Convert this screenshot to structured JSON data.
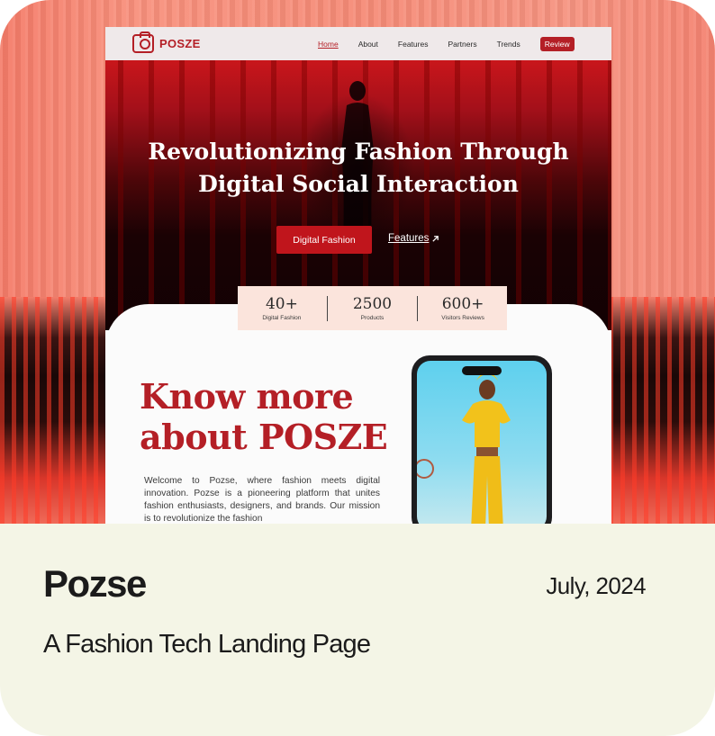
{
  "card": {
    "title": "Pozse",
    "date": "July, 2024",
    "subtitle": "A Fashion Tech Landing Page"
  },
  "site": {
    "logo_text": "POSZE",
    "nav": {
      "items": [
        {
          "label": "Home",
          "active": true
        },
        {
          "label": "About",
          "active": false
        },
        {
          "label": "Features",
          "active": false
        },
        {
          "label": "Partners",
          "active": false
        },
        {
          "label": "Trends",
          "active": false
        }
      ],
      "cta_label": "Review"
    },
    "hero": {
      "title_line1": "Revolutionizing Fashion Through",
      "title_line2": "Digital Social Interaction",
      "primary_button": "Digital Fashion",
      "secondary_link": "Features",
      "secondary_link_icon": "arrow-up-right-icon"
    },
    "stats": [
      {
        "value": "40+",
        "label": "Digital Fashion"
      },
      {
        "value": "2500",
        "label": "Products"
      },
      {
        "value": "600+",
        "label": "Visitors Reviews"
      }
    ],
    "about": {
      "title_line1": "Know more",
      "title_line2": "about POSZE",
      "text": "Welcome to Pozse, where fashion meets digital innovation. Pozse is a pioneering platform that unites fashion enthusiasts, designers, and brands. Our mission is to revolutionize the fashion"
    }
  },
  "colors": {
    "brand_red": "#b41f26",
    "caption_bg": "#f4f5e6",
    "stats_bg": "#fbe4dc"
  }
}
